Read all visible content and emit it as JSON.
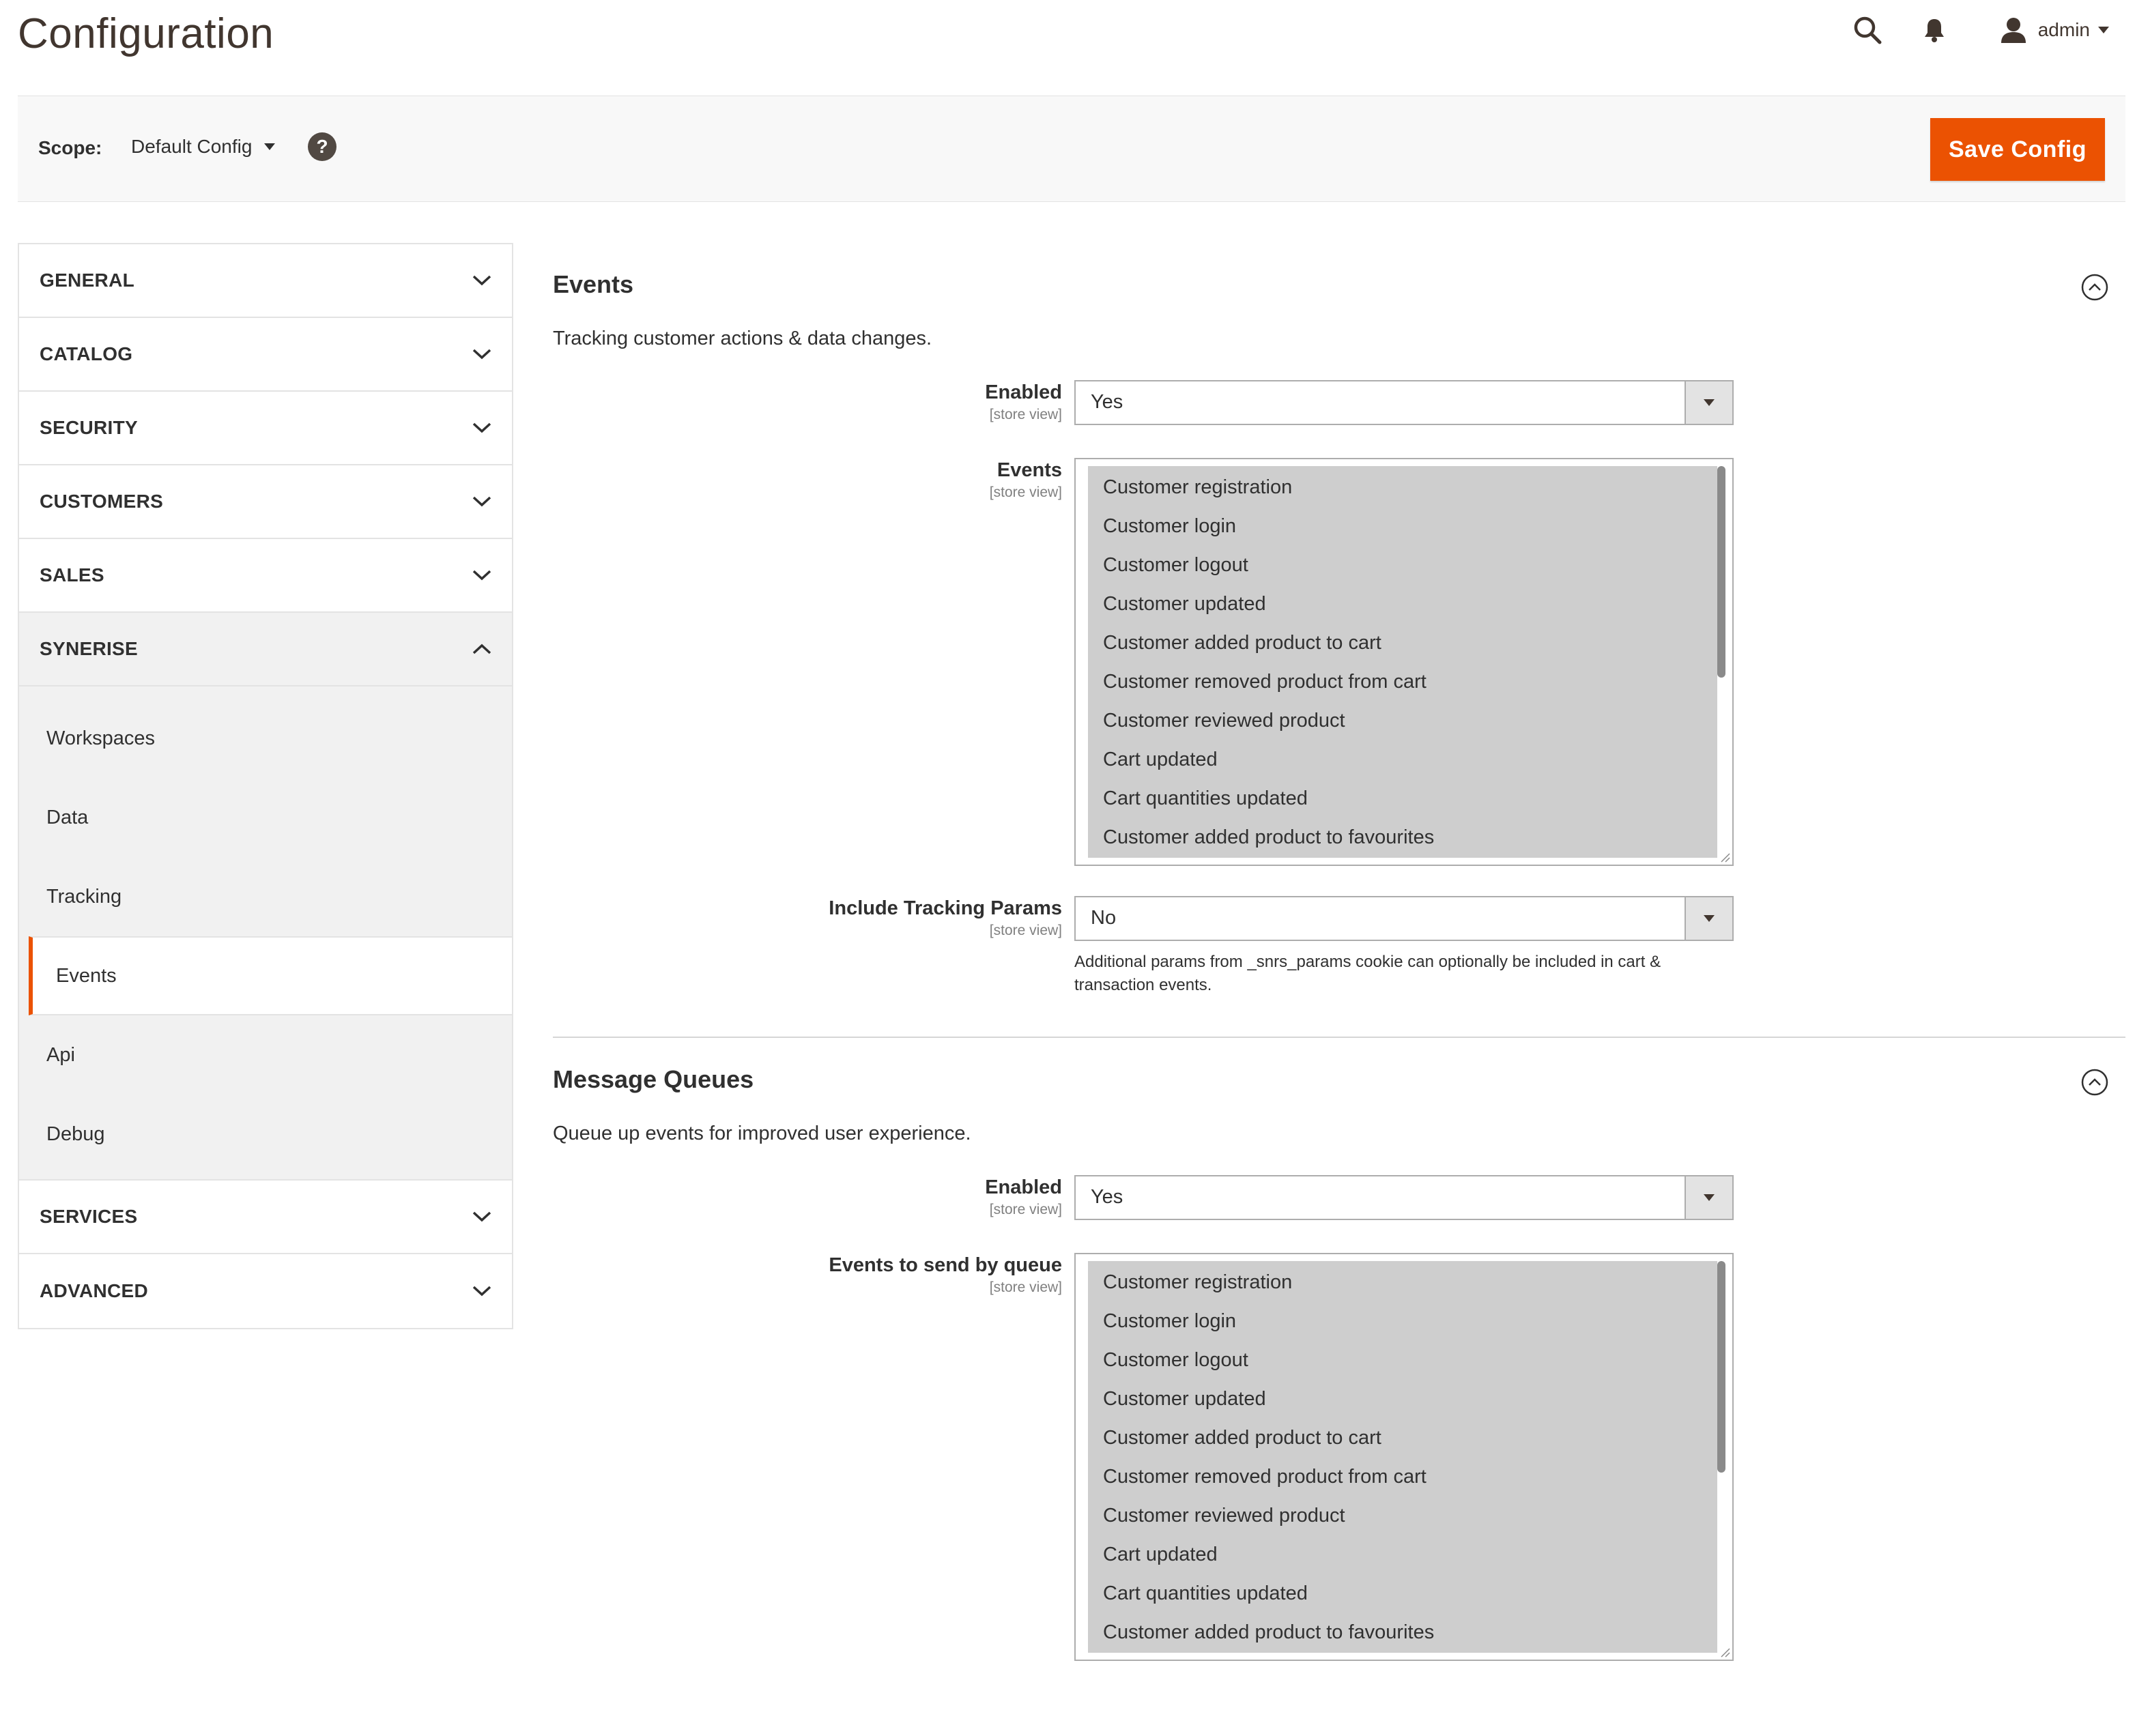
{
  "header": {
    "title": "Configuration",
    "user_name": "admin"
  },
  "scope": {
    "label": "Scope:",
    "value": "Default Config"
  },
  "actions": {
    "save_label": "Save Config"
  },
  "sidebar": {
    "sections_top": [
      {
        "title": "GENERAL"
      },
      {
        "title": "CATALOG"
      },
      {
        "title": "SECURITY"
      },
      {
        "title": "CUSTOMERS"
      },
      {
        "title": "SALES"
      }
    ],
    "open_section": {
      "title": "SYNERISE",
      "items": [
        "Workspaces",
        "Data",
        "Tracking",
        "Events",
        "Api",
        "Debug"
      ],
      "active_item": "Events"
    },
    "sections_bottom": [
      {
        "title": "SERVICES"
      },
      {
        "title": "ADVANCED"
      }
    ]
  },
  "sections": [
    {
      "title": "Events",
      "description": "Tracking customer actions & data changes.",
      "fields": {
        "enabled": {
          "label": "Enabled",
          "scope": "[store view]",
          "value": "Yes"
        },
        "events": {
          "label": "Events",
          "scope": "[store view]",
          "options": [
            "Customer registration",
            "Customer login",
            "Customer logout",
            "Customer updated",
            "Customer added product to cart",
            "Customer removed product from cart",
            "Customer reviewed product",
            "Cart updated",
            "Cart quantities updated",
            "Customer added product to favourites"
          ]
        },
        "tracking_params": {
          "label": "Include Tracking Params",
          "scope": "[store view]",
          "value": "No",
          "note": "Additional params from _snrs_params cookie can optionally be included in cart & transaction events."
        }
      }
    },
    {
      "title": "Message Queues",
      "description": "Queue up events for improved user experience.",
      "fields": {
        "enabled": {
          "label": "Enabled",
          "scope": "[store view]",
          "value": "Yes"
        },
        "events": {
          "label": "Events to send by queue",
          "scope": "[store view]",
          "options": [
            "Customer registration",
            "Customer login",
            "Customer logout",
            "Customer updated",
            "Customer added product to cart",
            "Customer removed product from cart",
            "Customer reviewed product",
            "Cart updated",
            "Cart quantities updated",
            "Customer added product to favourites"
          ]
        }
      }
    }
  ],
  "colors": {
    "accent": "#eb5202",
    "title_text": "#41362f",
    "selected_option_bg": "#cecece"
  },
  "icons": {
    "search": "search-icon",
    "notifications": "bell-icon",
    "user": "user-icon",
    "help": "help-icon",
    "collapse": "collapse-up-icon",
    "chevron": "chevron-down-icon"
  }
}
